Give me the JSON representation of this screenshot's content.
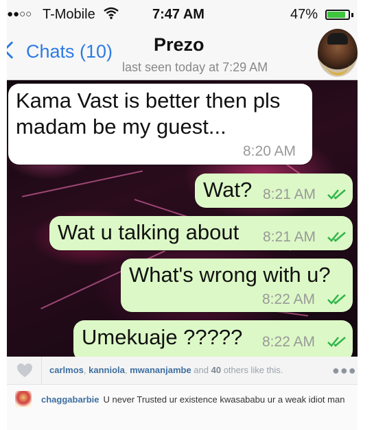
{
  "status_bar": {
    "signal": "●●○○",
    "carrier": "T-Mobile",
    "time": "7:47 AM",
    "battery_percent": "47%",
    "battery_level": 0.85,
    "battery_color": "#3ec63e"
  },
  "chat_header": {
    "back_label": "Chats (10)",
    "contact_name": "Prezo",
    "last_seen": "last seen today at 7:29 AM"
  },
  "messages": [
    {
      "direction": "incoming",
      "line1": "Kama Vast is better then pls",
      "line2": "madam be my guest...",
      "time": "8:20 AM"
    },
    {
      "direction": "outgoing",
      "text": "Wat?",
      "time": "8:21 AM",
      "status": "read"
    },
    {
      "direction": "outgoing",
      "text": "Wat u talking about",
      "time": "8:21 AM",
      "status": "read"
    },
    {
      "direction": "outgoing",
      "text": "What's wrong with u?",
      "time": "8:22 AM",
      "status": "read"
    },
    {
      "direction": "outgoing",
      "text": "Umekuaje ?????",
      "time": "8:22 AM",
      "status": "read"
    }
  ],
  "likes": {
    "users": [
      "carlmos",
      "kanniola",
      "mwananjambe"
    ],
    "sep1": ", ",
    "sep2": ", ",
    "and_word": " and ",
    "others_count": "40",
    "suffix": " others like this."
  },
  "comment": {
    "username": "chaggabarbie",
    "text": "U never Trusted ur existence kwasababu ur a weak idiot man"
  },
  "colors": {
    "ios_blue": "#2c7be5",
    "outgoing_bubble": "#dcf8c6",
    "incoming_bubble": "#ffffff",
    "read_ticks": "#2fb54a",
    "instagram_link": "#3f6fa0"
  }
}
